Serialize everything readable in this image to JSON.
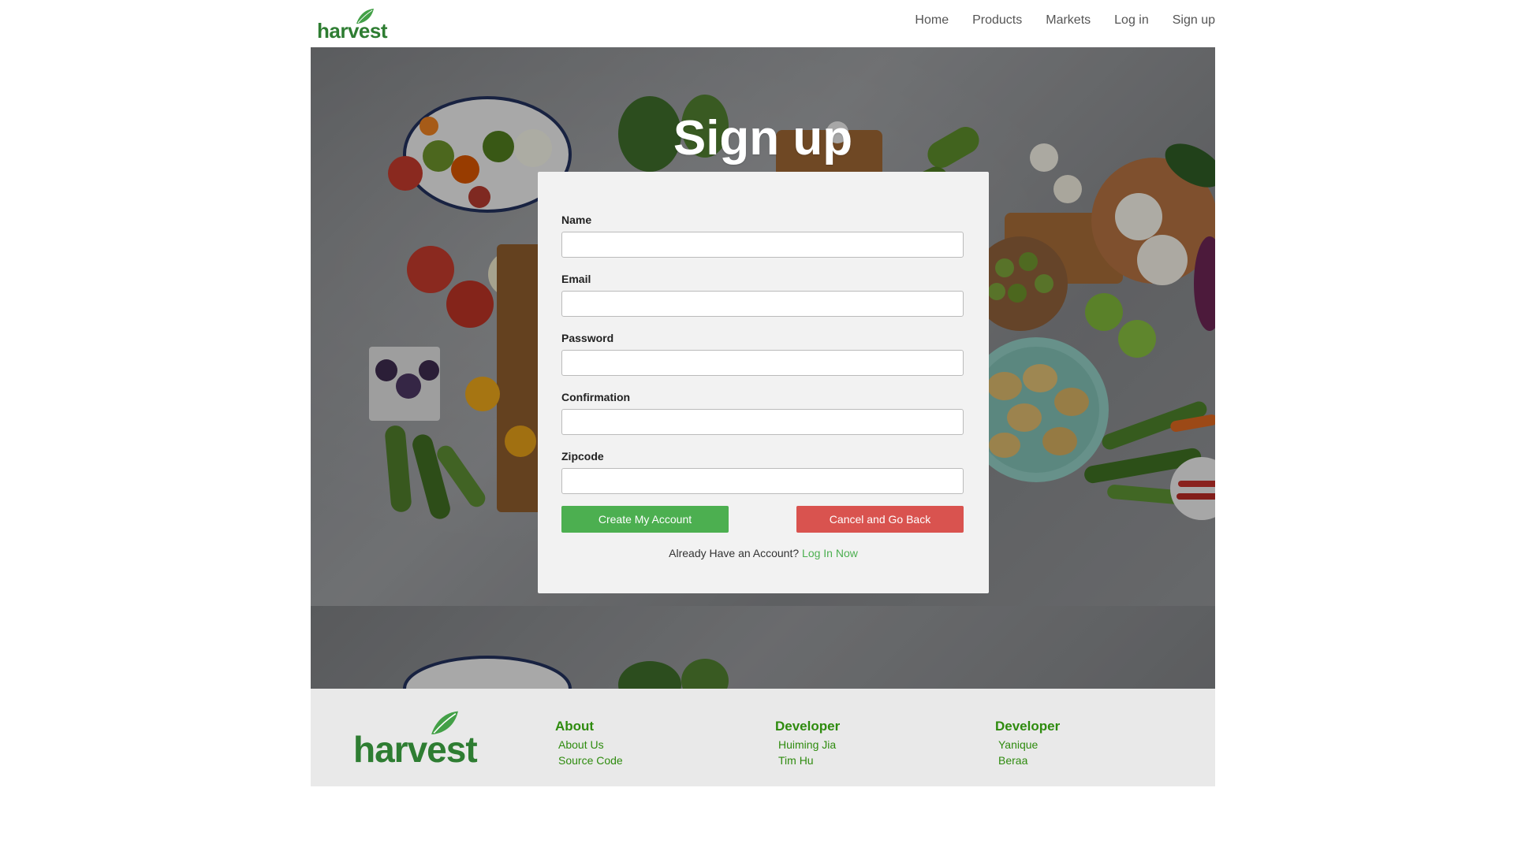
{
  "brand": {
    "name": "harvest",
    "color": "#2e7d32"
  },
  "nav": {
    "items": [
      {
        "label": "Home"
      },
      {
        "label": "Products"
      },
      {
        "label": "Markets"
      },
      {
        "label": "Log in"
      },
      {
        "label": "Sign up"
      }
    ]
  },
  "hero": {
    "title": "Sign up"
  },
  "form": {
    "fields": [
      {
        "label": "Name",
        "value": ""
      },
      {
        "label": "Email",
        "value": ""
      },
      {
        "label": "Password",
        "value": ""
      },
      {
        "label": "Confirmation",
        "value": ""
      },
      {
        "label": "Zipcode",
        "value": ""
      }
    ],
    "create_label": "Create My Account",
    "cancel_label": "Cancel and Go Back",
    "already_text": "Already Have an Account?",
    "login_link": "Log In Now",
    "colors": {
      "create": "#4caf50",
      "cancel": "#d9534f"
    }
  },
  "footer": {
    "columns": [
      {
        "heading": "About",
        "links": [
          "About Us",
          "Source Code"
        ]
      },
      {
        "heading": "Developer",
        "links": [
          "Huiming Jia",
          "Tim Hu"
        ]
      },
      {
        "heading": "Developer",
        "links": [
          "Yanique",
          "Beraa"
        ]
      }
    ]
  }
}
